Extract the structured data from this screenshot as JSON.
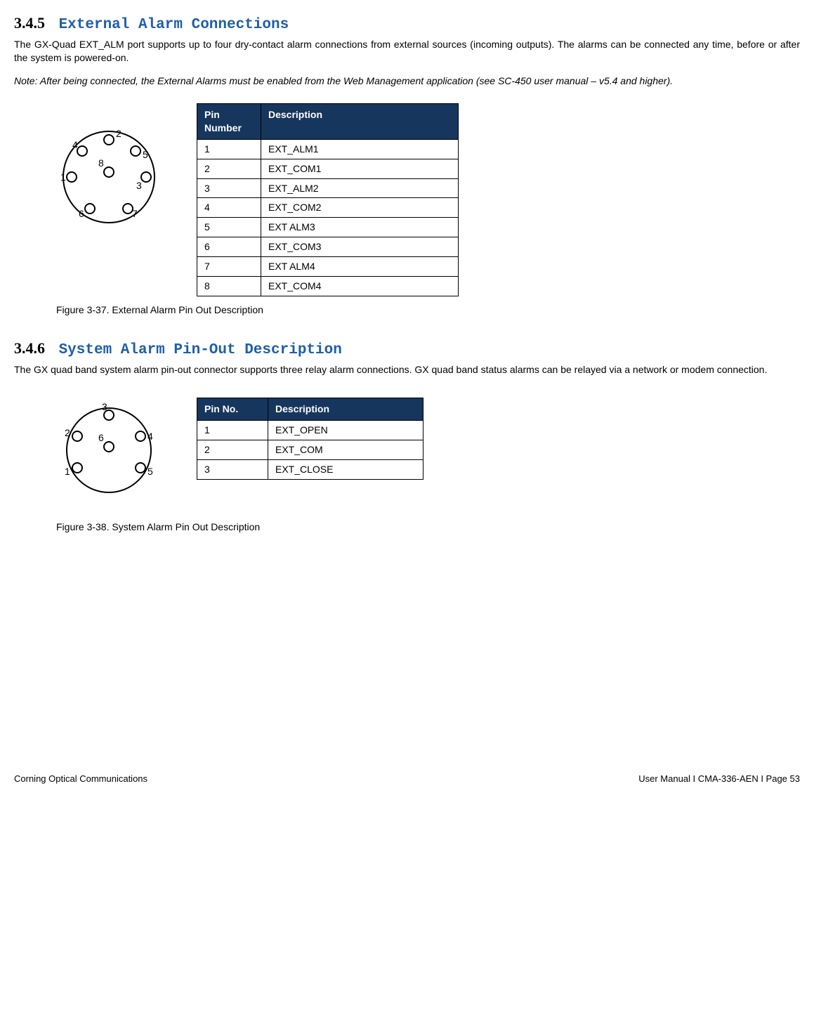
{
  "section345": {
    "number": "3.4.5",
    "title": "External Alarm Connections",
    "para": "The GX-Quad EXT_ALM port supports up to four dry-contact alarm connections from external sources (incoming outputs). The alarms can be connected any time, before or after the system is powered-on.",
    "note": "Note: After being connected, the External Alarms must be enabled from the Web Management application (see SC-450  user manual – v5.4 and higher).",
    "table_header_pin": "Pin Number",
    "table_header_desc": "Description",
    "rows": [
      {
        "pin": "1",
        "desc": "EXT_ALM1"
      },
      {
        "pin": "2",
        "desc": "EXT_COM1"
      },
      {
        "pin": "3",
        "desc": "EXT_ALM2"
      },
      {
        "pin": "4",
        "desc": "EXT_COM2"
      },
      {
        "pin": "5",
        "desc": "EXT ALM3"
      },
      {
        "pin": "6",
        "desc": "EXT_COM3"
      },
      {
        "pin": "7",
        "desc": "EXT ALM4"
      },
      {
        "pin": "8",
        "desc": "EXT_COM4"
      }
    ],
    "caption": "Figure 3-37. External Alarm Pin Out Description"
  },
  "section346": {
    "number": "3.4.6",
    "title": "System Alarm Pin-Out Description",
    "para": "The GX quad band system alarm pin-out connector supports three relay alarm connections. GX quad band status alarms can be relayed via a network or modem connection.",
    "table_header_pin": "Pin No.",
    "table_header_desc": "Description",
    "rows": [
      {
        "pin": "1",
        "desc": "EXT_OPEN"
      },
      {
        "pin": "2",
        "desc": "EXT_COM"
      },
      {
        "pin": "3",
        "desc": "EXT_CLOSE"
      }
    ],
    "caption": "Figure 3-38. System Alarm Pin Out Description"
  },
  "diagram8": {
    "labels": {
      "p1": "1",
      "p2": "2",
      "p3": "3",
      "p4": "4",
      "p5": "5",
      "p6": "6",
      "p7": "7",
      "p8": "8"
    }
  },
  "diagram6": {
    "labels": {
      "p1": "1",
      "p2": "2",
      "p3": "3",
      "p4": "4",
      "p5": "5",
      "p6": "6"
    }
  },
  "footer": {
    "left": "Corning Optical Communications",
    "right": "User Manual I CMA-336-AEN I Page 53"
  }
}
